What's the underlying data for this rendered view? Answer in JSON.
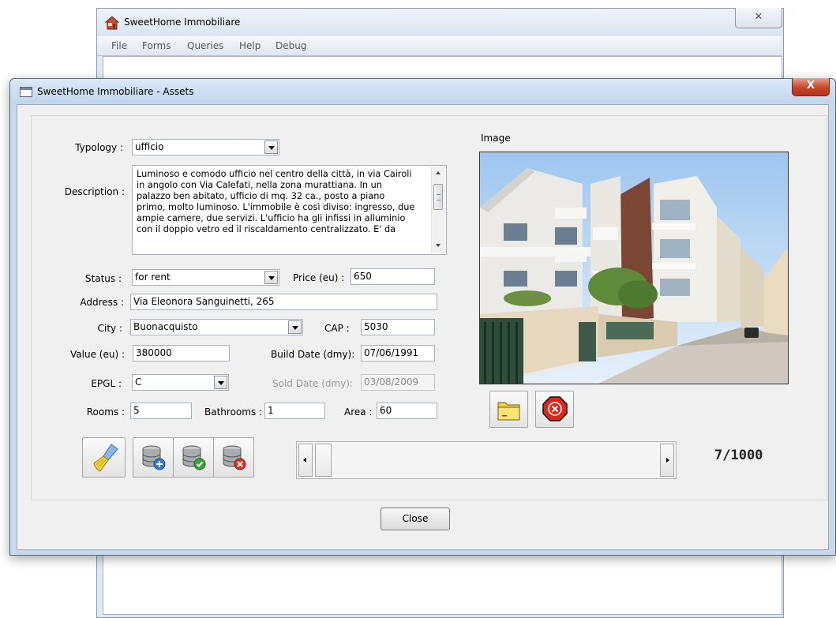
{
  "background_window": {
    "title": "SweetHome Immobiliare",
    "close_glyph": "✕",
    "menu": [
      "File",
      "Forms",
      "Queries",
      "Help",
      "Debug"
    ]
  },
  "dialog": {
    "title": "SweetHome Immobiliare - Assets",
    "close_glyph": "X",
    "image_label": "Image",
    "form": {
      "typology": {
        "label": "Typology :",
        "value": "ufficio"
      },
      "description": {
        "label": "Description :",
        "value": "Luminoso e comodo ufficio nel centro della città, in via Cairoli\nin angolo con Via Calefati, nella zona murattiana. In un\npalazzo ben abitato, ufficio di mq. 32 ca., posto a piano\nprimo, molto luminoso. L'immobile è così diviso: ingresso, due\nampie camere, due servizi. L'ufficio ha gli infissi in alluminio\ncon il doppio vetro ed il riscaldamento centralizzato. E' da"
      },
      "status": {
        "label": "Status :",
        "value": "for rent"
      },
      "price": {
        "label": "Price (eu) :",
        "value": "650"
      },
      "address": {
        "label": "Address :",
        "value": "Via Eleonora Sanguinetti, 265"
      },
      "city": {
        "label": "City :",
        "value": "Buonacquisto"
      },
      "cap": {
        "label": "CAP :",
        "value": "5030"
      },
      "value_eu": {
        "label": "Value (eu) :",
        "value": "380000"
      },
      "build_date": {
        "label": "Build Date (dmy):",
        "value": "07/06/1991"
      },
      "epgl": {
        "label": "EPGL :",
        "value": "C"
      },
      "sold_date": {
        "label": "Sold Date (dmy):",
        "value": "03/08/2009",
        "enabled": false
      },
      "rooms": {
        "label": "Rooms :",
        "value": "5"
      },
      "bathrooms": {
        "label": "Bathrooms :",
        "value": "1"
      },
      "area": {
        "label": "Area :",
        "value": "60"
      }
    },
    "toolbar": {
      "icons": [
        "clear-broom-icon",
        "db-add-icon",
        "db-save-icon",
        "db-delete-icon",
        "open-folder-icon",
        "remove-image-icon"
      ]
    },
    "navigator": {
      "position_text": "7/1000",
      "current": 7,
      "total": 1000
    },
    "close_button": "Close"
  },
  "colors": {
    "dialog_frame": "#c8d9ee",
    "client_bg": "#f0f0f0",
    "close_red": "#c7452a",
    "stop_red": "#e0261a"
  }
}
